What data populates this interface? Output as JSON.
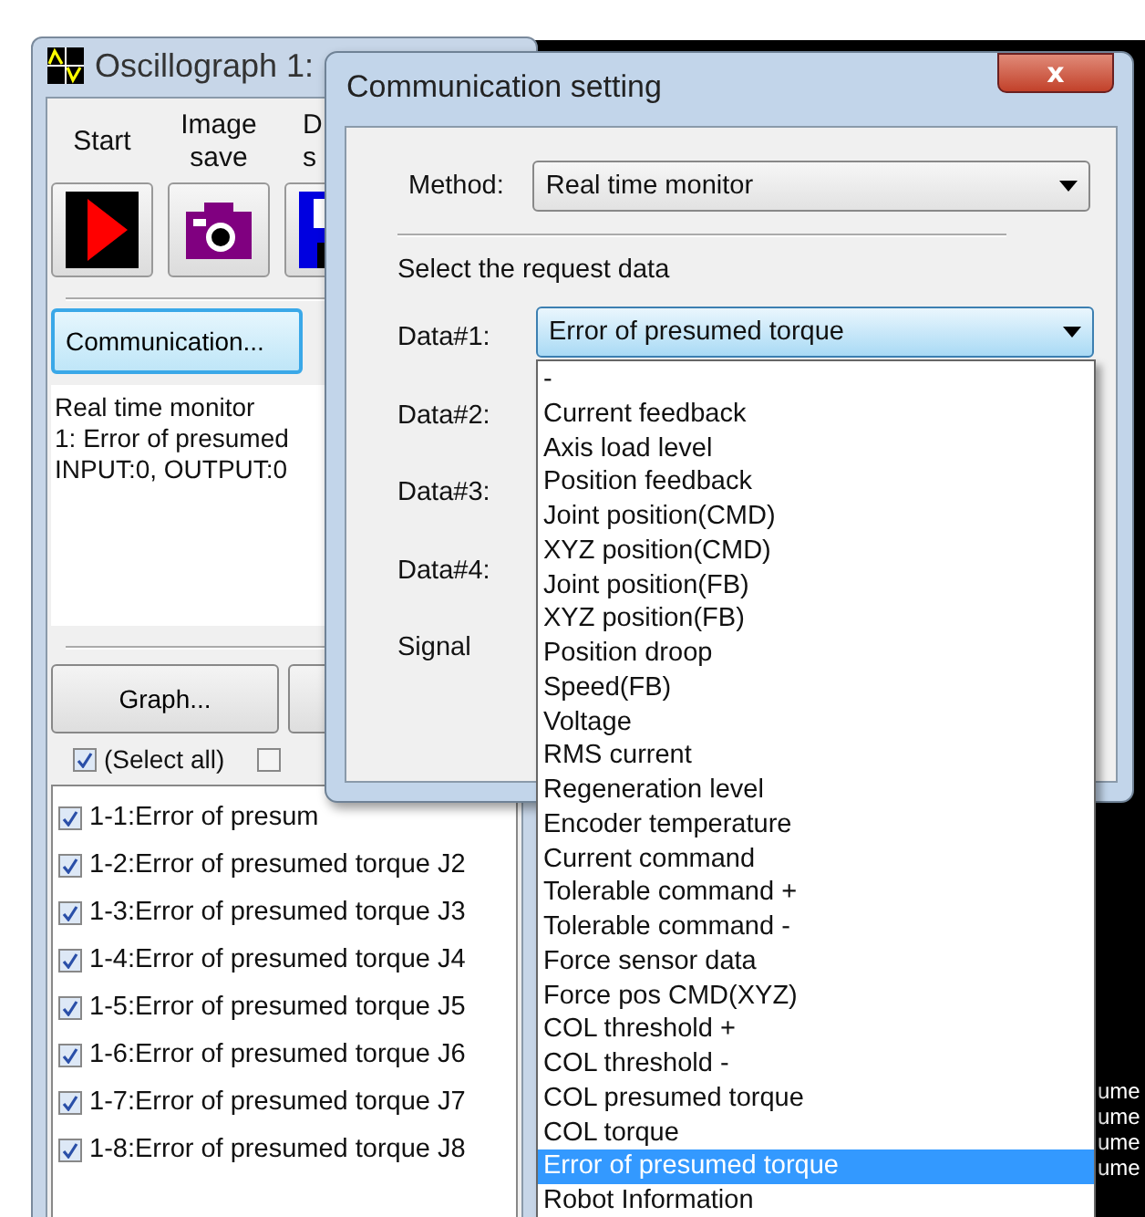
{
  "main_window": {
    "title": "Oscillograph 1:",
    "toolbar": [
      {
        "kind": "start",
        "lines": [
          "Start"
        ]
      },
      {
        "kind": "camera",
        "lines": [
          "Image",
          "save"
        ]
      },
      {
        "kind": "disk",
        "lines": [
          "D",
          "s"
        ]
      }
    ],
    "communication_button": "Communication...",
    "info_lines": [
      "Real time monitor",
      "1: Error of presumed",
      "INPUT:0, OUTPUT:0"
    ],
    "graph_button": "Graph...",
    "select_all": {
      "label": "(Select all)",
      "checked": true
    },
    "second_checkbox": {
      "checked": false
    },
    "channels": [
      {
        "label": "1-1:Error of presum",
        "checked": true
      },
      {
        "label": "1-2:Error of presumed torque J2",
        "checked": true
      },
      {
        "label": "1-3:Error of presumed torque J3",
        "checked": true
      },
      {
        "label": "1-4:Error of presumed torque J4",
        "checked": true
      },
      {
        "label": "1-5:Error of presumed torque J5",
        "checked": true
      },
      {
        "label": "1-6:Error of presumed torque J6",
        "checked": true
      },
      {
        "label": "1-7:Error of presumed torque J7",
        "checked": true
      },
      {
        "label": "1-8:Error of presumed torque J8",
        "checked": true
      }
    ],
    "side_texts": [
      "ume",
      "ume",
      "ume",
      "ume"
    ]
  },
  "dialog": {
    "title": "Communication setting",
    "close": "x",
    "method_label": "Method:",
    "method_value": "Real time monitor",
    "section_label": "Select the request data",
    "data_labels": [
      "Data#1:",
      "Data#2:",
      "Data#3:",
      "Data#4:",
      "Signal"
    ],
    "data1_value": "Error of presumed torque",
    "options": [
      {
        "label": "-",
        "selected": false
      },
      {
        "label": "Current feedback",
        "selected": false
      },
      {
        "label": "Axis load level",
        "selected": false
      },
      {
        "label": "Position feedback",
        "selected": false
      },
      {
        "label": "Joint position(CMD)",
        "selected": false
      },
      {
        "label": "XYZ position(CMD)",
        "selected": false
      },
      {
        "label": "Joint position(FB)",
        "selected": false
      },
      {
        "label": "XYZ position(FB)",
        "selected": false
      },
      {
        "label": "Position droop",
        "selected": false
      },
      {
        "label": "Speed(FB)",
        "selected": false
      },
      {
        "label": "Voltage",
        "selected": false
      },
      {
        "label": "RMS current",
        "selected": false
      },
      {
        "label": "Regeneration level",
        "selected": false
      },
      {
        "label": "Encoder temperature",
        "selected": false
      },
      {
        "label": "Current command",
        "selected": false
      },
      {
        "label": "Tolerable command +",
        "selected": false
      },
      {
        "label": "Tolerable command -",
        "selected": false
      },
      {
        "label": "Force sensor data",
        "selected": false
      },
      {
        "label": "Force pos CMD(XYZ)",
        "selected": false
      },
      {
        "label": "COL threshold +",
        "selected": false
      },
      {
        "label": "COL threshold -",
        "selected": false
      },
      {
        "label": "COL presumed torque",
        "selected": false
      },
      {
        "label": "COL torque",
        "selected": false
      },
      {
        "label": "Error of presumed torque",
        "selected": true
      },
      {
        "label": "Robot Information",
        "selected": false
      }
    ]
  }
}
